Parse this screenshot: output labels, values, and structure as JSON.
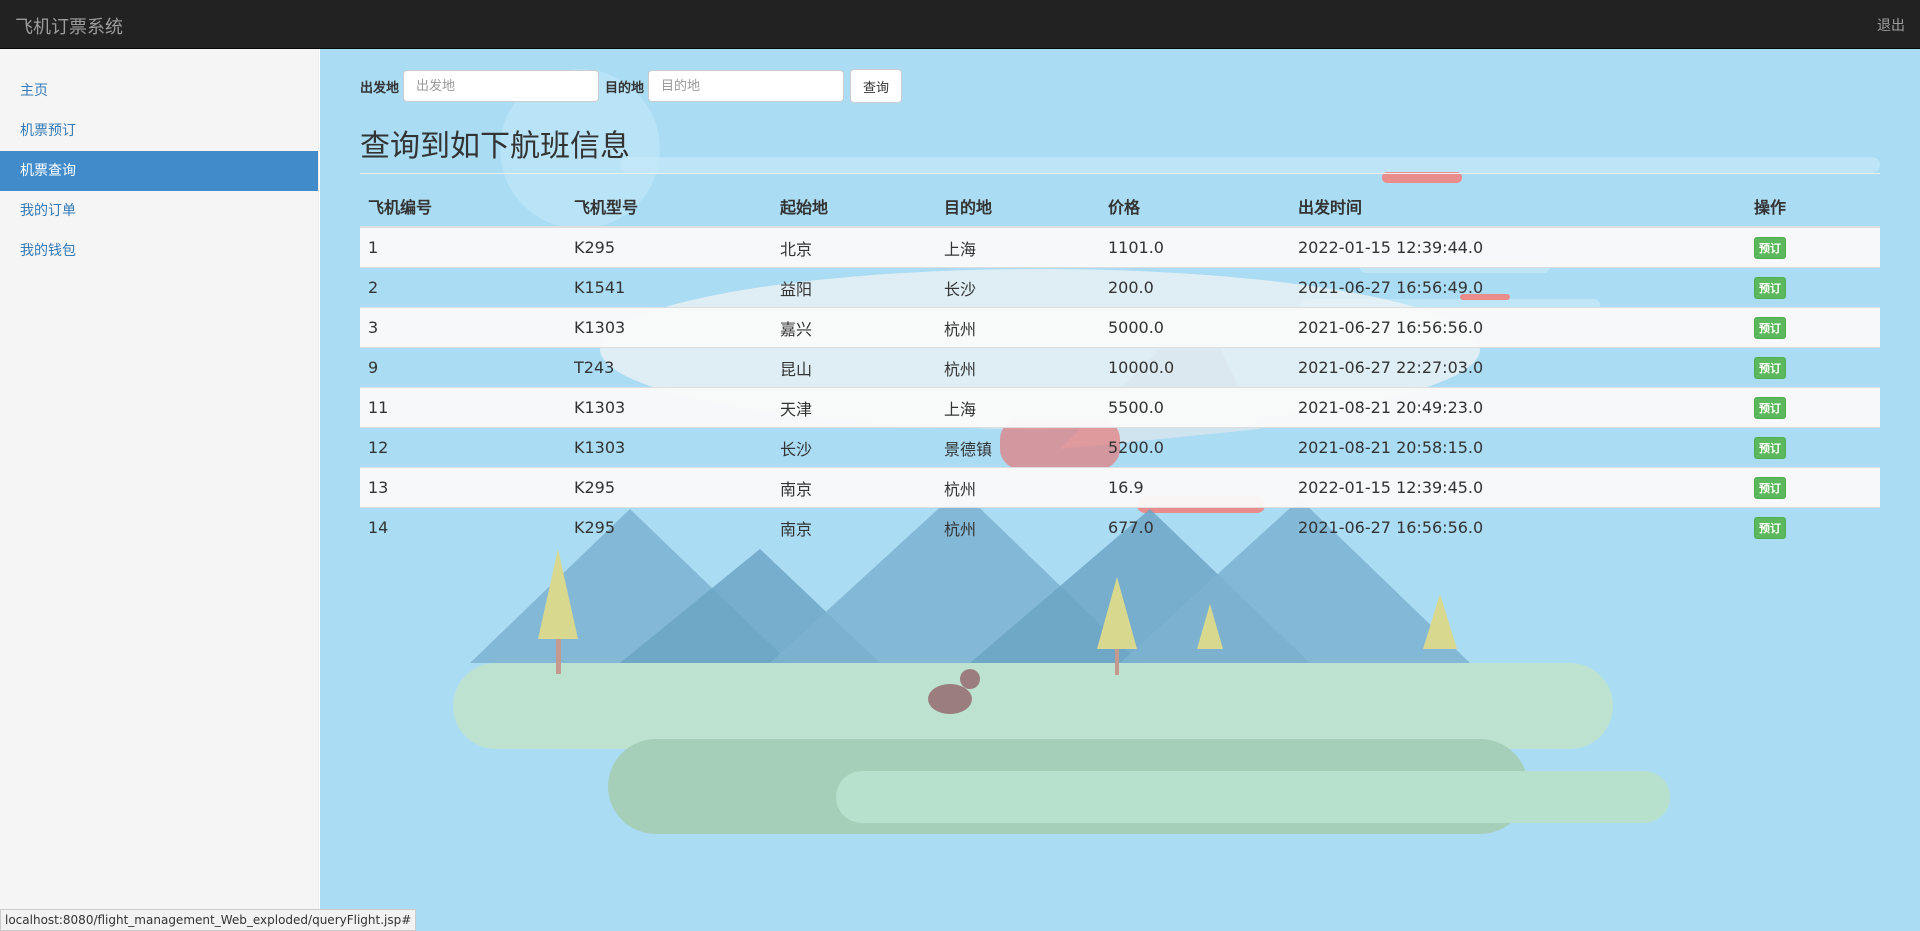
{
  "navbar": {
    "brand": "飞机订票系统",
    "logout": "退出"
  },
  "sidebar": {
    "items": [
      {
        "label": "主页",
        "active": false
      },
      {
        "label": "机票预订",
        "active": false
      },
      {
        "label": "机票查询",
        "active": true
      },
      {
        "label": "我的订单",
        "active": false
      },
      {
        "label": "我的钱包",
        "active": false
      }
    ]
  },
  "search": {
    "from_label": "出发地",
    "from_placeholder": "出发地",
    "to_label": "目的地",
    "to_placeholder": "目的地",
    "query_button": "查询"
  },
  "main": {
    "title": "查询到如下航班信息"
  },
  "table": {
    "headers": [
      "飞机编号",
      "飞机型号",
      "起始地",
      "目的地",
      "价格",
      "出发时间",
      "操作"
    ],
    "book_label": "预订",
    "rows": [
      [
        "1",
        "K295",
        "北京",
        "上海",
        "1101.0",
        "2022-01-15 12:39:44.0"
      ],
      [
        "2",
        "K1541",
        "益阳",
        "长沙",
        "200.0",
        "2021-06-27 16:56:49.0"
      ],
      [
        "3",
        "K1303",
        "嘉兴",
        "杭州",
        "5000.0",
        "2021-06-27 16:56:56.0"
      ],
      [
        "9",
        "T243",
        "昆山",
        "杭州",
        "10000.0",
        "2021-06-27 22:27:03.0"
      ],
      [
        "11",
        "K1303",
        "天津",
        "上海",
        "5500.0",
        "2021-08-21 20:49:23.0"
      ],
      [
        "12",
        "K1303",
        "长沙",
        "景德镇",
        "5200.0",
        "2021-08-21 20:58:15.0"
      ],
      [
        "13",
        "K295",
        "南京",
        "杭州",
        "16.9",
        "2022-01-15 12:39:45.0"
      ],
      [
        "14",
        "K295",
        "南京",
        "杭州",
        "677.0",
        "2021-06-27 16:56:56.0"
      ]
    ]
  },
  "statusbar": {
    "url": "localhost:8080/flight_management_Web_exploded/queryFlight.jsp#"
  },
  "colors": {
    "navbar_bg": "#222222",
    "sidebar_bg": "#f5f5f5",
    "sidebar_active": "#428bca",
    "link": "#337ab7",
    "main_bg": "#aadcf4",
    "book_button": "#5cb85c"
  }
}
